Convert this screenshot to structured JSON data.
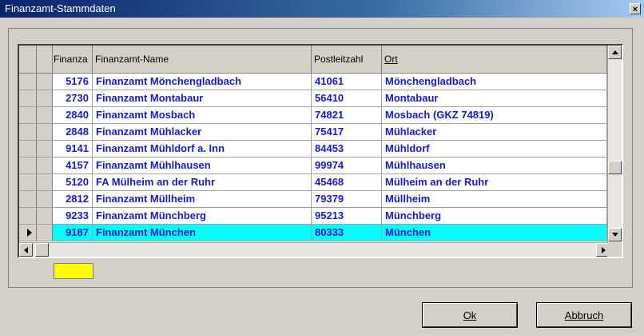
{
  "window": {
    "title": "Finanzamt-Stammdaten",
    "close_glyph": "×"
  },
  "grid": {
    "columns": [
      "Finanza",
      "Finanzamt-Name",
      "Postleitzahl",
      "Ort"
    ],
    "rows": [
      {
        "nr": "5176",
        "name": "Finanzamt Mönchengladbach",
        "plz": "41061",
        "ort": "Mönchengladbach"
      },
      {
        "nr": "2730",
        "name": "Finanzamt Montabaur",
        "plz": "56410",
        "ort": "Montabaur"
      },
      {
        "nr": "2840",
        "name": "Finanzamt Mosbach",
        "plz": "74821",
        "ort": "Mosbach (GKZ 74819)"
      },
      {
        "nr": "2848",
        "name": "Finanzamt Mühlacker",
        "plz": "75417",
        "ort": "Mühlacker"
      },
      {
        "nr": "9141",
        "name": "Finanzamt Mühldorf a. Inn",
        "plz": "84453",
        "ort": "Mühldorf"
      },
      {
        "nr": "4157",
        "name": "Finanzamt Mühlhausen",
        "plz": "99974",
        "ort": "Mühlhausen"
      },
      {
        "nr": "5120",
        "name": "FA Mülheim an der Ruhr",
        "plz": "45468",
        "ort": "Mülheim an der Ruhr"
      },
      {
        "nr": "2812",
        "name": "Finanzamt Müllheim",
        "plz": "79379",
        "ort": "Müllheim"
      },
      {
        "nr": "9233",
        "name": "Finanzamt Münchberg",
        "plz": "95213",
        "ort": "Münchberg"
      },
      {
        "nr": "9187",
        "name": "Finanzamt München",
        "plz": "80333",
        "ort": "München"
      }
    ],
    "selected_row_color": "#00ffff",
    "text_color": "#1a1acc"
  },
  "buttons": {
    "ok": "Ok",
    "cancel": "Abbruch"
  },
  "icons": {
    "row_pointer": "triangle-right-icon"
  }
}
